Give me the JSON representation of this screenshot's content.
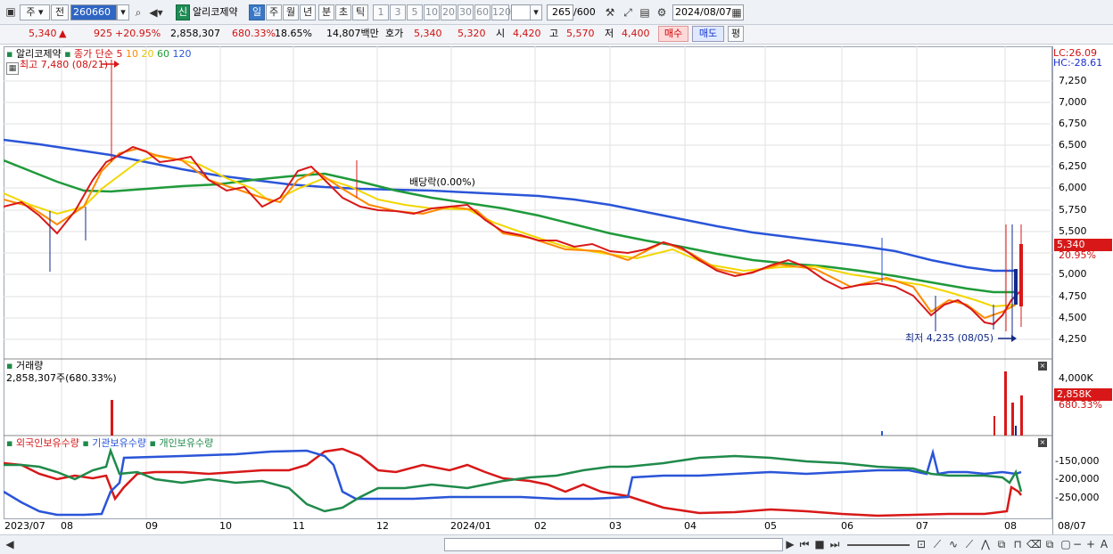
{
  "toolbar": {
    "type_select": "주",
    "type_select2": "전",
    "code": "260660",
    "badge_new": "신",
    "stock_name": "알리코제약",
    "periods": [
      "일",
      "주",
      "월",
      "년",
      "분",
      "초",
      "틱"
    ],
    "period_selected": "일",
    "intervals": [
      "1",
      "3",
      "5",
      "10",
      "20",
      "30",
      "60",
      "120"
    ],
    "count_input": "265",
    "count_total": "/600",
    "date_input": "2024/08/07"
  },
  "quote": {
    "price": "5,340",
    "change": "925",
    "change_rate": "+20.95%",
    "volume": "2,858,307",
    "volume_rate": "680.33%",
    "turnover": "18.65%",
    "amount": "14,807백만",
    "bid_label": "호가",
    "bid1": "5,340",
    "bid2": "5,320",
    "open_label": "시",
    "open": "4,420",
    "high_label": "고",
    "high": "5,570",
    "low_label": "저",
    "low": "4,400",
    "buy_button": "매수",
    "sell_button": "매도",
    "eval_button": "평"
  },
  "price_pane": {
    "name": "알리코제약",
    "ma_label": "종가 단순",
    "ma_periods": [
      "5",
      "10",
      "20",
      "60",
      "120"
    ],
    "ma_colors": [
      "#d81818",
      "#ff8a00",
      "#f2d600",
      "#1f9a3a",
      "#2a55d8"
    ],
    "high_note": "최고 7,480 (08/21)",
    "low_note": "최저 4,235 (08/05)",
    "dividend_note": "배당락(0.00%)",
    "lc": "LC:26.09",
    "hc": "HC:-28.61",
    "y_ticks": [
      "7,250",
      "7,000",
      "6,750",
      "6,500",
      "6,250",
      "6,000",
      "5,750",
      "5,500",
      "5,250",
      "5,000",
      "4,750",
      "4,500",
      "4,250"
    ],
    "current_price_tag": "5,340",
    "current_rate_tag": "20.95%"
  },
  "volume_pane": {
    "title": "거래량",
    "value": "2,858,307주(680.33%)",
    "y_tick": "4,000K",
    "current_tag": "2,858K",
    "current_rate": "680.33%"
  },
  "holdings_pane": {
    "series": [
      "외국인보유수량",
      "기관보유수량",
      "개인보유수량"
    ],
    "series_colors": [
      "#d81818",
      "#2a55d8",
      "#1f8a4a"
    ],
    "y_ticks": [
      "-150,000",
      "-200,000",
      "-250,000"
    ]
  },
  "x_axis": {
    "labels": [
      "2023/07",
      "08",
      "09",
      "10",
      "11",
      "12",
      "2024/01",
      "02",
      "03",
      "04",
      "05",
      "06",
      "07",
      "08"
    ],
    "right_label": "08/07"
  }
}
